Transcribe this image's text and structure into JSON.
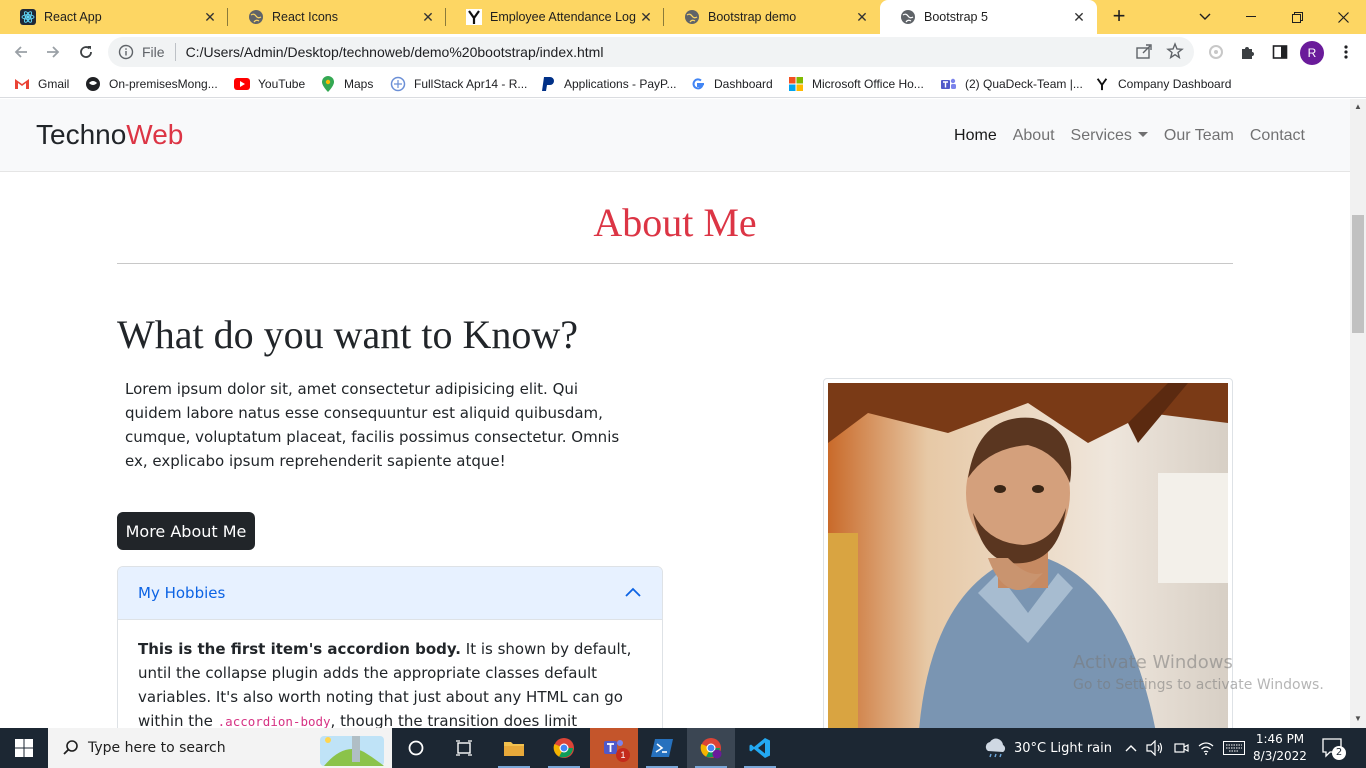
{
  "browser": {
    "tabs": [
      {
        "title": "React App",
        "icon": "react-icon"
      },
      {
        "title": "React Icons",
        "icon": "globe-icon"
      },
      {
        "title": "Employee Attendance Log",
        "icon": "y-logo-icon"
      },
      {
        "title": "Bootstrap demo",
        "icon": "globe-icon"
      },
      {
        "title": "Bootstrap 5",
        "icon": "globe-icon",
        "active": true
      }
    ],
    "address": {
      "file_label": "File",
      "url": "C:/Users/Admin/Desktop/technoweb/demo%20bootstrap/index.html"
    },
    "profile_initial": "R",
    "bookmarks": [
      {
        "label": "Gmail",
        "icon": "gmail-icon"
      },
      {
        "label": "On-premisesMong...",
        "icon": "mongo-icon"
      },
      {
        "label": "YouTube",
        "icon": "youtube-icon"
      },
      {
        "label": "Maps",
        "icon": "maps-icon"
      },
      {
        "label": "FullStack Apr14 - R...",
        "icon": "fullstack-icon"
      },
      {
        "label": "Applications - PayP...",
        "icon": "paypal-icon"
      },
      {
        "label": "Dashboard",
        "icon": "google-icon"
      },
      {
        "label": "Microsoft Office Ho...",
        "icon": "microsoft-icon"
      },
      {
        "label": "(2) QuaDeck-Team |...",
        "icon": "teams-icon"
      },
      {
        "label": "Company Dashboard",
        "icon": "y-logo-icon"
      }
    ]
  },
  "site": {
    "brand_main": "Techno",
    "brand_accent": "Web",
    "nav": [
      {
        "label": "Home",
        "active": true
      },
      {
        "label": "About"
      },
      {
        "label": "Services",
        "dropdown": true
      },
      {
        "label": "Our Team"
      },
      {
        "label": "Contact"
      }
    ],
    "section_title": "About Me",
    "heading": "What do you want to Know?",
    "lead": "Lorem ipsum dolor sit, amet consectetur adipisicing elit. Qui quidem labore natus esse consequuntur est aliquid quibusdam, cumque, voluptatum placeat, facilis possimus consectetur. Omnis ex, explicabo ipsum reprehenderit sapiente atque!",
    "more_button": "More About Me",
    "accordion": {
      "header": "My Hobbies",
      "body_bold": "This is the first item's accordion body.",
      "body_text1": " It is shown by default, until the collapse plugin adds the appropriate classes default variables. It's also worth noting that just about any HTML can go within the ",
      "body_code": ".accordion-body",
      "body_text2": ", though the transition does limit overflow."
    }
  },
  "watermark": {
    "line1": "Activate Windows",
    "line2": "Go to Settings to activate Windows."
  },
  "taskbar": {
    "search_placeholder": "Type here to search",
    "weather": "30°C  Light rain",
    "time": "1:46 PM",
    "date": "8/3/2022",
    "notifications": "2",
    "teams_badge": "1"
  },
  "colors": {
    "accent": "#dc3545",
    "tabstrip": "#fdd663",
    "accordion_header_bg": "#e7f1ff",
    "accordion_header_text": "#0c63e4"
  }
}
